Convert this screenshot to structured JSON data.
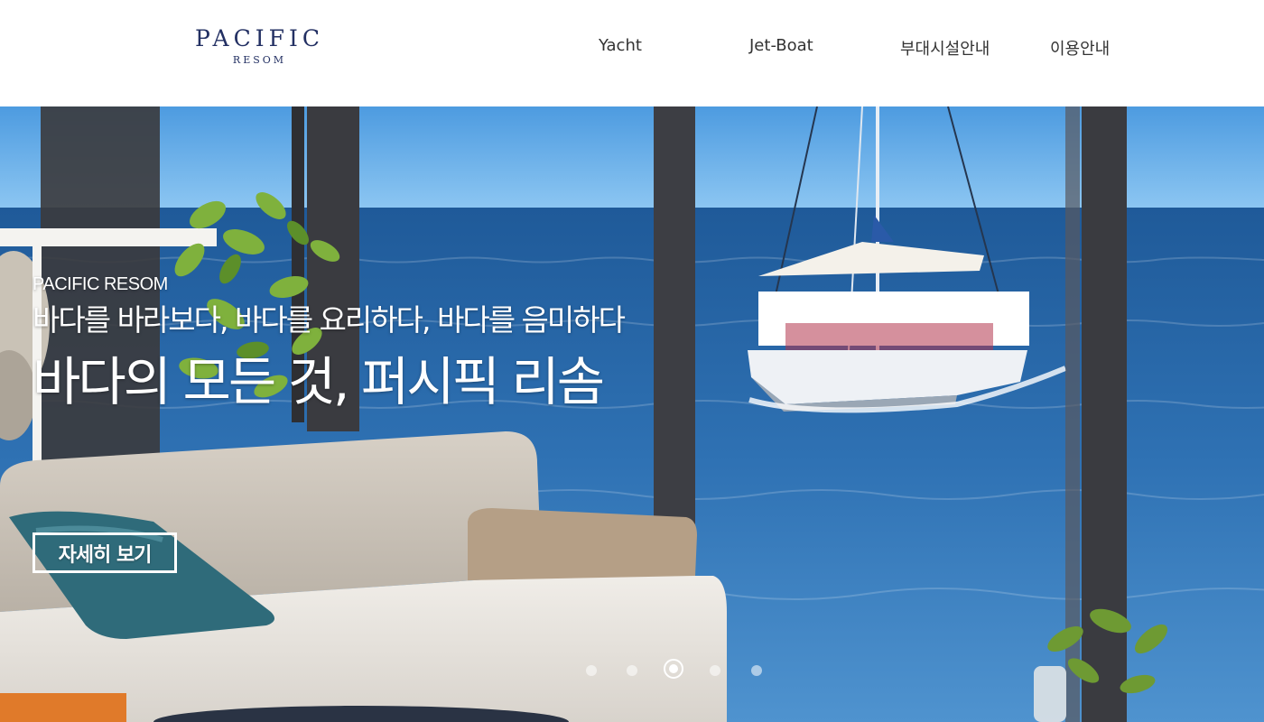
{
  "header": {
    "logo": {
      "main": "PACIFIC",
      "sub": "RESOM"
    },
    "nav": [
      {
        "label": "Yacht"
      },
      {
        "label": "Jet-Boat"
      },
      {
        "label": "부대시설안내"
      },
      {
        "label": "이용안내"
      }
    ]
  },
  "hero": {
    "brand": "PACIFIC RESOM",
    "tagline": "바다를 바라보다, 바다를 요리하다, 바다를 음미하다",
    "title": "바다의 모든 것, 퍼시픽 리솜",
    "button_label": "자세히 보기",
    "background_image": "lounge-sea-view-catamaran",
    "slider": {
      "total_slides": 5,
      "active_slide": 3
    }
  },
  "colors": {
    "logo": "#233063",
    "nav_text": "#333333",
    "hero_text": "#ffffff",
    "sky": "#5aa6e8",
    "sea": "#2f6fae"
  }
}
